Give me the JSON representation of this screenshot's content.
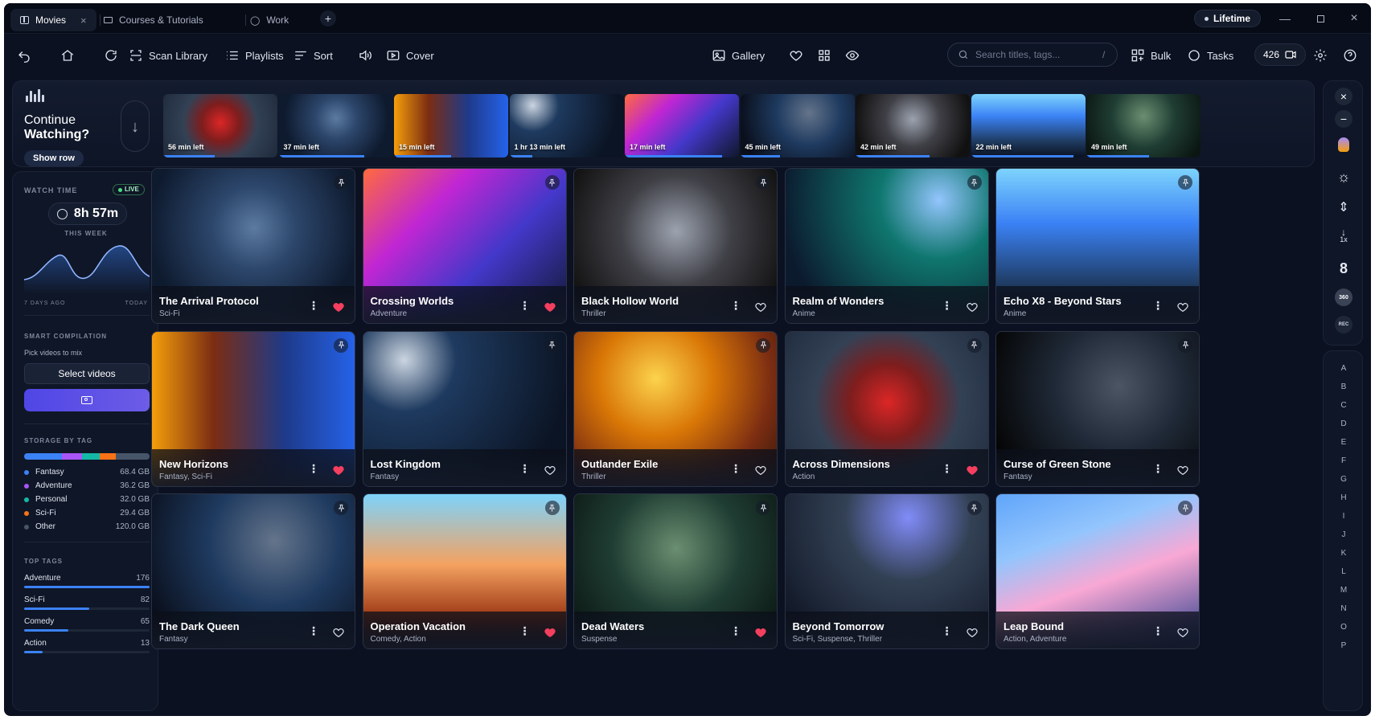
{
  "tabs": [
    {
      "label": "Movies",
      "active": true
    },
    {
      "label": "Courses & Tutorials"
    },
    {
      "label": "Work"
    }
  ],
  "window": {
    "plan_label": "Lifetime"
  },
  "toolbar": {
    "scan": "Scan Library",
    "playlists": "Playlists",
    "sort": "Sort",
    "cover": "Cover",
    "gallery": "Gallery",
    "bulk": "Bulk",
    "tasks": "Tasks",
    "count": "426",
    "search_placeholder": "Search titles, tags...",
    "search_shortcut": "/"
  },
  "continue": {
    "title_line1": "Continue",
    "title_line2": "Watching?",
    "show_row": "Show row",
    "items": [
      {
        "time": "56 min left",
        "progress": 0.45,
        "theme": "emblem"
      },
      {
        "time": "37 min left",
        "progress": 0.75,
        "theme": "space"
      },
      {
        "time": "15 min left",
        "progress": 0.5,
        "theme": "portal"
      },
      {
        "time": "1 hr 13 min left",
        "progress": 0.2,
        "theme": "night"
      },
      {
        "time": "17 min left",
        "progress": 0.85,
        "theme": "cosmic"
      },
      {
        "time": "45 min left",
        "progress": 0.35,
        "theme": "queen"
      },
      {
        "time": "42 min left",
        "progress": 0.65,
        "theme": "mono"
      },
      {
        "time": "22 min left",
        "progress": 0.9,
        "theme": "robot"
      },
      {
        "time": "49 min left",
        "progress": 0.55,
        "theme": "pirate"
      }
    ]
  },
  "sidebar": {
    "watch_time_label": "WATCH TIME",
    "live": "LIVE",
    "watch_time": "8h 57m",
    "this_week": "THIS WEEK",
    "days_ago": "7 DAYS AGO",
    "today": "TODAY",
    "smart_label": "SMART COMPILATION",
    "smart_hint": "Pick videos to mix",
    "select_videos": "Select videos",
    "storage_label": "STORAGE BY TAG",
    "storage": [
      {
        "name": "Fantasy",
        "size": "68.4 GB",
        "color": "#3b82f6"
      },
      {
        "name": "Adventure",
        "size": "36.2 GB",
        "color": "#a855f7"
      },
      {
        "name": "Personal",
        "size": "32.0 GB",
        "color": "#14b8a6"
      },
      {
        "name": "Sci-Fi",
        "size": "29.4 GB",
        "color": "#f97316"
      },
      {
        "name": "Other",
        "size": "120.0 GB",
        "color": "#475569"
      }
    ],
    "top_tags_label": "TOP TAGS",
    "top_tags": [
      {
        "name": "Adventure",
        "count": "176",
        "ratio": 1.0
      },
      {
        "name": "Sci-Fi",
        "count": "82",
        "ratio": 0.52
      },
      {
        "name": "Comedy",
        "count": "65",
        "ratio": 0.35
      },
      {
        "name": "Action",
        "count": "13",
        "ratio": 0.15
      }
    ]
  },
  "grid": [
    {
      "title": "The Arrival Protocol",
      "genre": "Sci-Fi",
      "fav": true,
      "theme": "space"
    },
    {
      "title": "Crossing Worlds",
      "genre": "Adventure",
      "fav": true,
      "theme": "cosmic"
    },
    {
      "title": "Black Hollow World",
      "genre": "Thriller",
      "fav": false,
      "theme": "mono"
    },
    {
      "title": "Realm of Wonders",
      "genre": "Anime",
      "fav": false,
      "theme": "realm"
    },
    {
      "title": "Echo X8 - Beyond Stars",
      "genre": "Anime",
      "fav": false,
      "theme": "robot"
    },
    {
      "title": "New Horizons",
      "genre": "Fantasy, Sci-Fi",
      "fav": true,
      "theme": "portal"
    },
    {
      "title": "Lost Kingdom",
      "genre": "Fantasy",
      "fav": false,
      "theme": "night"
    },
    {
      "title": "Outlander Exile",
      "genre": "Thriller",
      "fav": false,
      "theme": "desert"
    },
    {
      "title": "Across Dimensions",
      "genre": "Action",
      "fav": true,
      "theme": "emblem"
    },
    {
      "title": "Curse of Green Stone",
      "genre": "Fantasy",
      "fav": false,
      "theme": "dark"
    },
    {
      "title": "The Dark Queen",
      "genre": "Fantasy",
      "fav": false,
      "theme": "queen"
    },
    {
      "title": "Operation Vacation",
      "genre": "Comedy, Action",
      "fav": true,
      "theme": "sunny"
    },
    {
      "title": "Dead Waters",
      "genre": "Suspense",
      "fav": true,
      "theme": "pirate"
    },
    {
      "title": "Beyond Tomorrow",
      "genre": "Sci-Fi, Suspense, Thriller",
      "fav": false,
      "theme": "ruins"
    },
    {
      "title": "Leap Bound",
      "genre": "Action, Adventure",
      "fav": false,
      "theme": "city"
    }
  ],
  "rail": {
    "badge_360": "360",
    "badge_rec": "REC",
    "speed": "1x"
  },
  "alphabet": [
    "A",
    "B",
    "C",
    "D",
    "E",
    "F",
    "G",
    "H",
    "I",
    "J",
    "K",
    "L",
    "M",
    "N",
    "O",
    "P"
  ],
  "colors": {
    "accent": "#3b82f6",
    "heart": "#f43f5e",
    "bg": "#0b1120"
  }
}
